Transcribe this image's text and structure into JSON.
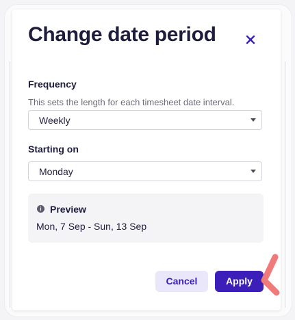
{
  "dialog": {
    "title": "Change date period",
    "close_icon": "close-icon"
  },
  "frequency": {
    "label": "Frequency",
    "helper": "This sets the length for each timesheet date interval.",
    "selected": "Weekly"
  },
  "starting_on": {
    "label": "Starting on",
    "selected": "Monday"
  },
  "preview": {
    "icon": "info-icon",
    "title": "Preview",
    "value": "Mon, 7 Sep - Sun, 13 Sep"
  },
  "actions": {
    "cancel_label": "Cancel",
    "apply_label": "Apply"
  },
  "colors": {
    "accent": "#3b1fb8",
    "secondary_button_bg": "#ebe7fb",
    "text_primary": "#1f1d3d",
    "pointer": "#f07a7a"
  }
}
